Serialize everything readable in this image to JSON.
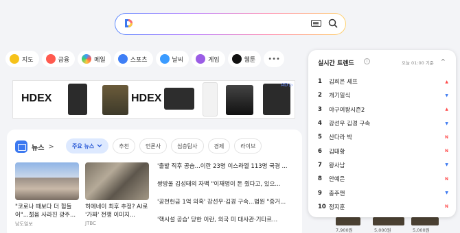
{
  "search": {
    "placeholder": ""
  },
  "shortcuts": [
    {
      "label": "지도",
      "icon": "map-pin-icon",
      "color": "#f6c21a"
    },
    {
      "label": "금융",
      "icon": "finance-icon",
      "color": "#ff5a4f"
    },
    {
      "label": "메일",
      "icon": "mail-icon",
      "color": "#3b9bff"
    },
    {
      "label": "스포츠",
      "icon": "sports-icon",
      "color": "#3f7ff6"
    },
    {
      "label": "날씨",
      "icon": "weather-icon",
      "color": "#3b9bff"
    },
    {
      "label": "게임",
      "icon": "game-icon",
      "color": "#9b5de5"
    },
    {
      "label": "웹툰",
      "icon": "webtoon-icon",
      "color": "#111111"
    }
  ],
  "more_label": "•••",
  "ad": {
    "brand": "HDEX",
    "ad_label": "AD ▷"
  },
  "news": {
    "title": "뉴스",
    "arrow": ">",
    "tabs": [
      "주요 뉴스",
      "추천",
      "언론사",
      "심층탐사",
      "경제",
      "라이브"
    ],
    "cards": [
      {
        "caption": "\"코로나 때보다 더 힘들어\"...젊음 사라진 광주...",
        "source": "남도일보"
      },
      {
        "caption": "히에네이 최후 추정? AI로 '가짜' 전쟁 이미지...",
        "source": "JTBC"
      }
    ],
    "headlines": [
      "'출발 직후 공습...이란 23명 이스라엘 113명 국경 ...",
      "쌍방울 김성태의 자백 \"이재명이 돈 줬다고, 있으...",
      "'공천헌금 1억 의혹' 강선우·김경 구속...법원 \"증거...",
      "'핵시설 공습' 당한 이란, 외국 미 대사관·기타르..."
    ]
  },
  "trend": {
    "title": "실시간 트렌드",
    "info": "i",
    "time": "오늘 01:00 기준",
    "collapse": "^",
    "items": [
      {
        "rank": "1",
        "keyword": "김희은 셰프",
        "status": "up"
      },
      {
        "rank": "2",
        "keyword": "개기일식",
        "status": "down"
      },
      {
        "rank": "3",
        "keyword": "야구여왕시즌2",
        "status": "up"
      },
      {
        "rank": "4",
        "keyword": "강선우 김경 구속",
        "status": "down"
      },
      {
        "rank": "5",
        "keyword": "산다라 박",
        "status": "new"
      },
      {
        "rank": "6",
        "keyword": "김태황",
        "status": "new"
      },
      {
        "rank": "7",
        "keyword": "왕사남",
        "status": "down"
      },
      {
        "rank": "8",
        "keyword": "안예은",
        "status": "new"
      },
      {
        "rank": "9",
        "keyword": "충주맨",
        "status": "down"
      },
      {
        "rank": "10",
        "keyword": "정지훈",
        "status": "new"
      }
    ],
    "status_glyphs": {
      "up": "▲",
      "down": "▼",
      "new": "N"
    },
    "status_colors": {
      "up": "#ff4b4b",
      "down": "#3b78f0",
      "new": "#ff4b4b"
    }
  },
  "shop": {
    "prices": [
      "7,900원",
      "5,000원",
      "5,000원"
    ]
  }
}
